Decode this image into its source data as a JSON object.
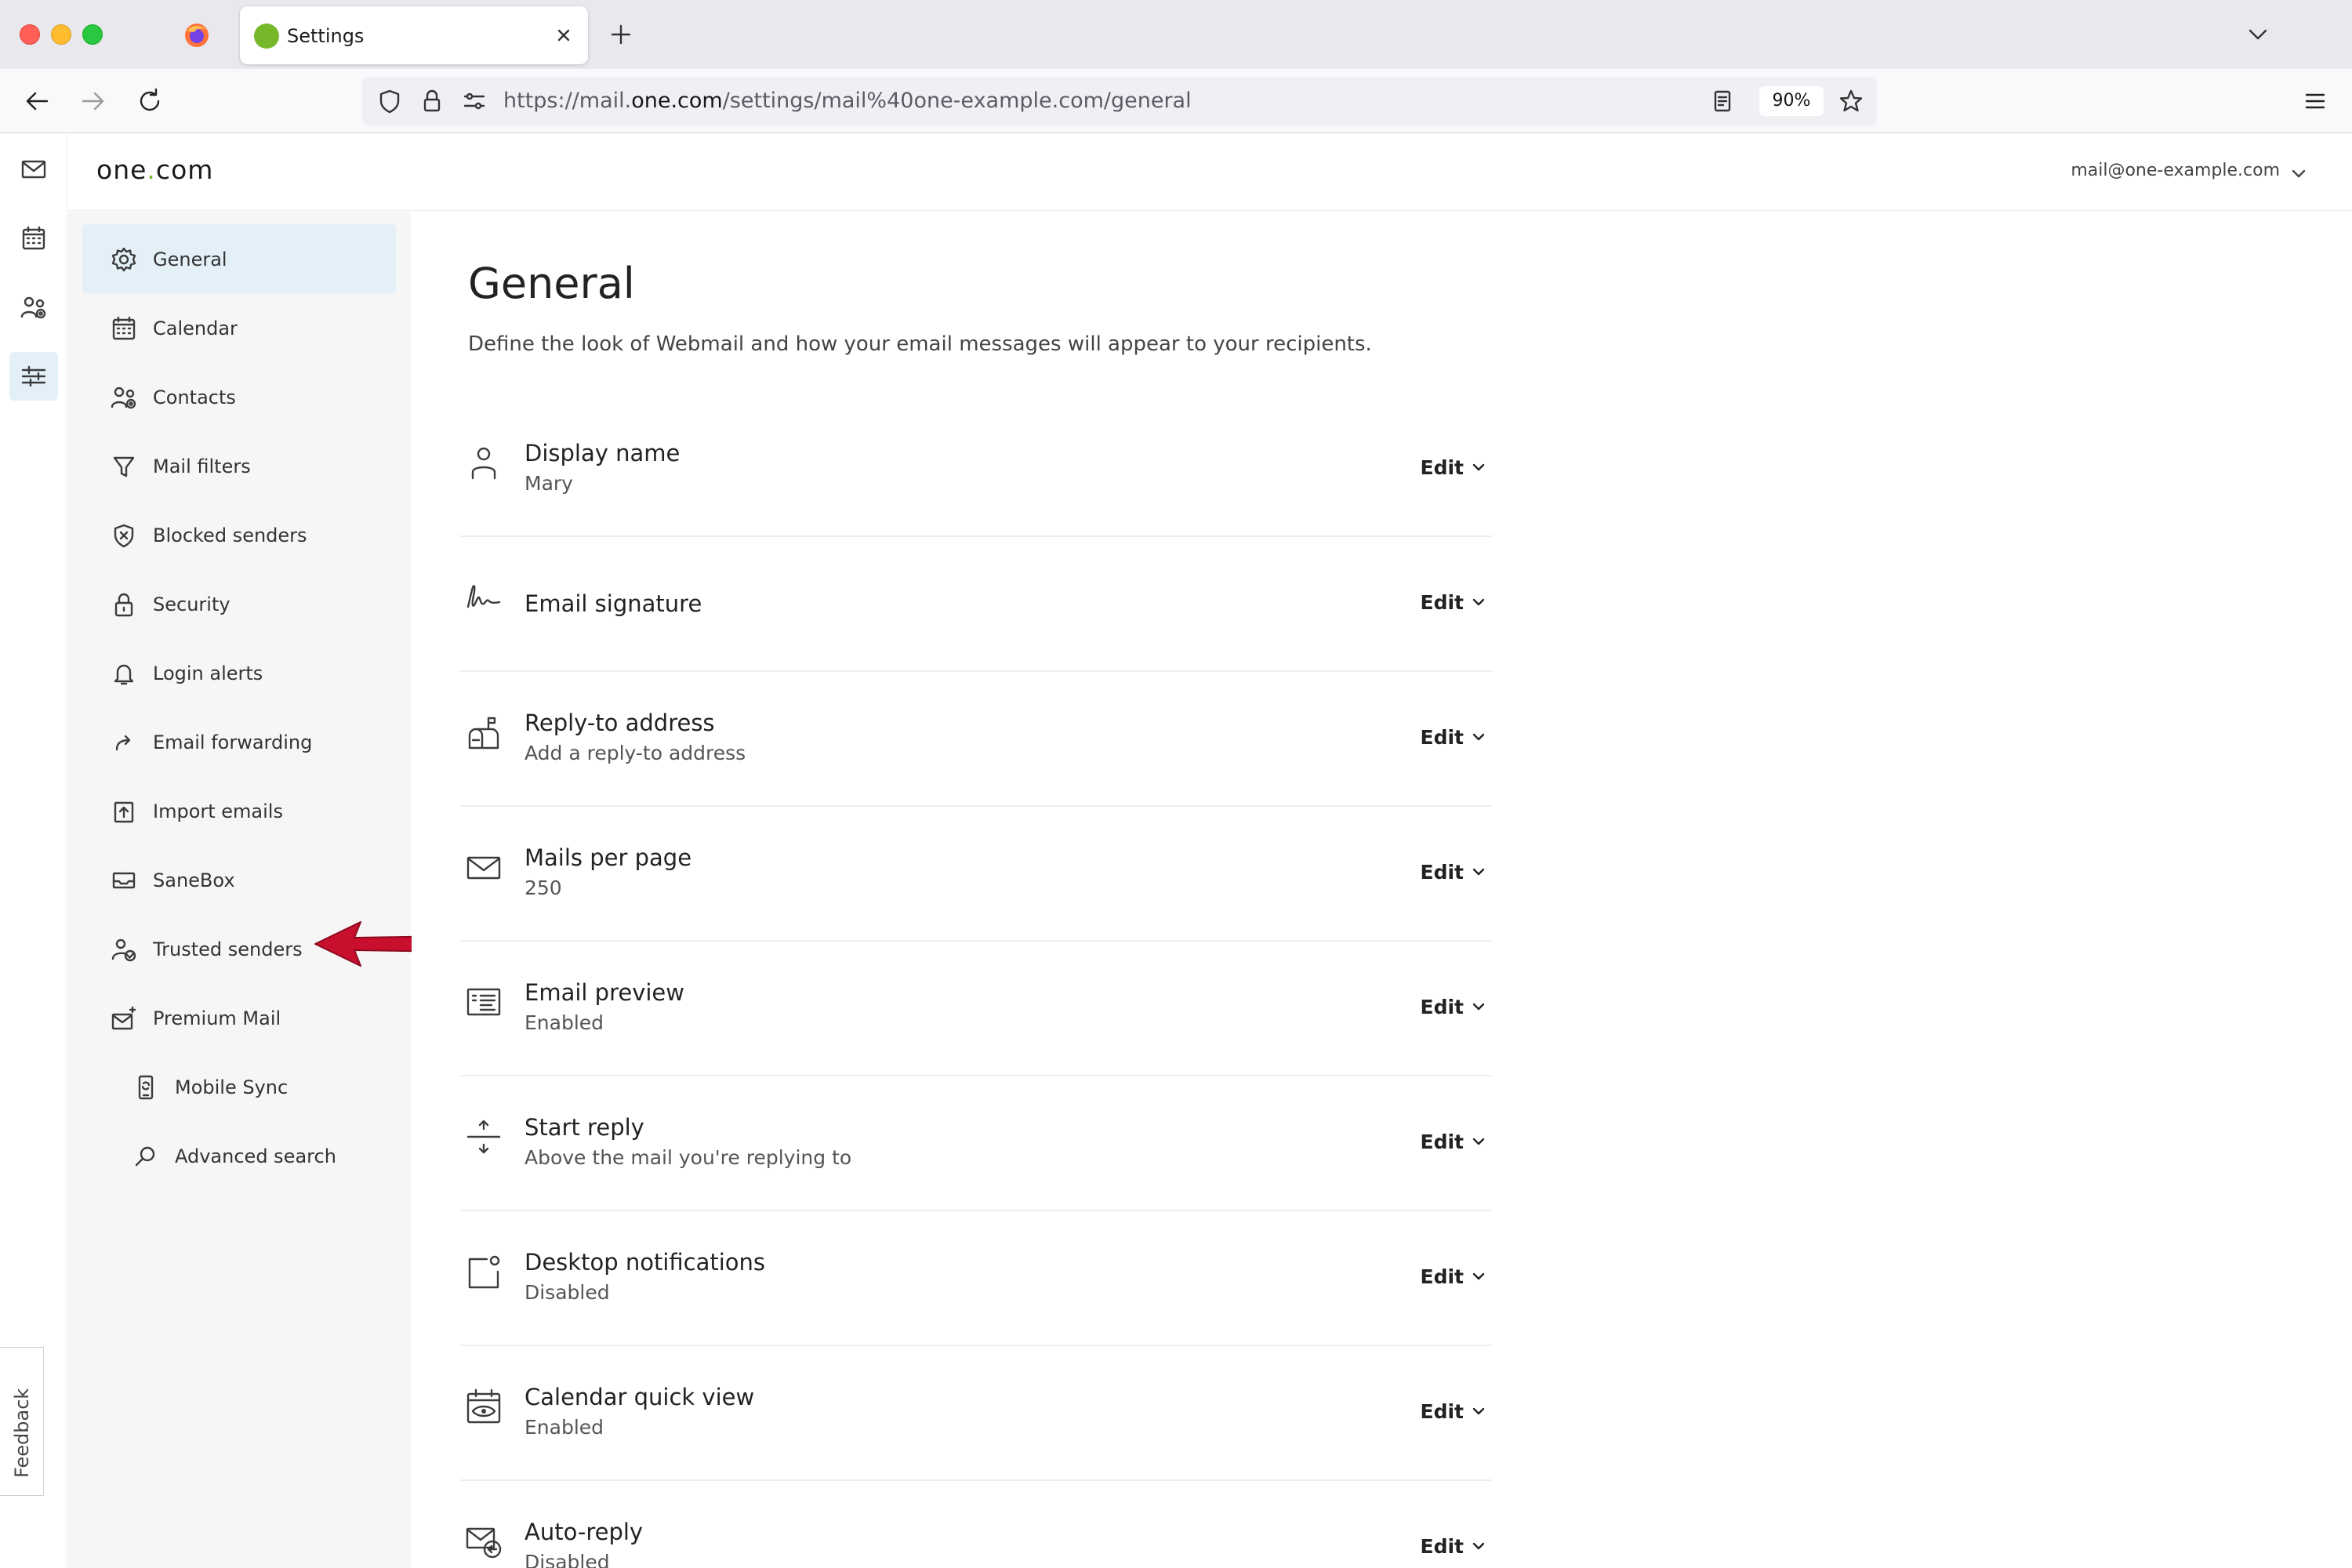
{
  "browser": {
    "tab_title": "Settings",
    "url_prefix": "https://mail.",
    "url_domain": "one.com",
    "url_suffix": "/settings/mail%40one-example.com/general",
    "zoom": "90%"
  },
  "app": {
    "logo_left": "one",
    "logo_dot": ".",
    "logo_right": "com",
    "account": "mail@one-example.com",
    "feedback": "Feedback"
  },
  "sidebar": {
    "items": [
      {
        "label": "General",
        "icon": "gear-icon"
      },
      {
        "label": "Calendar",
        "icon": "calendar-icon"
      },
      {
        "label": "Contacts",
        "icon": "contacts-icon"
      },
      {
        "label": "Mail filters",
        "icon": "filter-icon"
      },
      {
        "label": "Blocked senders",
        "icon": "shield-icon"
      },
      {
        "label": "Security",
        "icon": "lock-icon"
      },
      {
        "label": "Login alerts",
        "icon": "bell-icon"
      },
      {
        "label": "Email forwarding",
        "icon": "forward-icon"
      },
      {
        "label": "Import emails",
        "icon": "import-icon"
      },
      {
        "label": "SaneBox",
        "icon": "inbox-icon"
      },
      {
        "label": "Trusted senders",
        "icon": "trusted-user-icon"
      },
      {
        "label": "Premium Mail",
        "icon": "premium-mail-icon"
      },
      {
        "label": "Mobile Sync",
        "icon": "mobile-icon"
      },
      {
        "label": "Advanced search",
        "icon": "search-icon"
      }
    ]
  },
  "main": {
    "title": "General",
    "description": "Define the look of Webmail and how your email messages will appear to your recipients.",
    "edit_label": "Edit",
    "settings": [
      {
        "title": "Display name",
        "value": "Mary",
        "icon": "person-icon"
      },
      {
        "title": "Email signature",
        "value": "",
        "icon": "signature-icon"
      },
      {
        "title": "Reply-to address",
        "value": "Add a reply-to address",
        "icon": "mailbox-icon"
      },
      {
        "title": "Mails per page",
        "value": "250",
        "icon": "envelope-icon"
      },
      {
        "title": "Email preview",
        "value": "Enabled",
        "icon": "preview-icon"
      },
      {
        "title": "Start reply",
        "value": "Above the mail you're replying to",
        "icon": "reply-position-icon"
      },
      {
        "title": "Desktop notifications",
        "value": "Disabled",
        "icon": "notification-icon"
      },
      {
        "title": "Calendar quick view",
        "value": "Enabled",
        "icon": "calendar-eye-icon"
      },
      {
        "title": "Auto-reply",
        "value": "Disabled",
        "icon": "auto-reply-icon"
      }
    ]
  },
  "colors": {
    "brand_green": "#76b82a",
    "active_bg": "#e3f0f8",
    "annotation_red": "#c8102e"
  }
}
